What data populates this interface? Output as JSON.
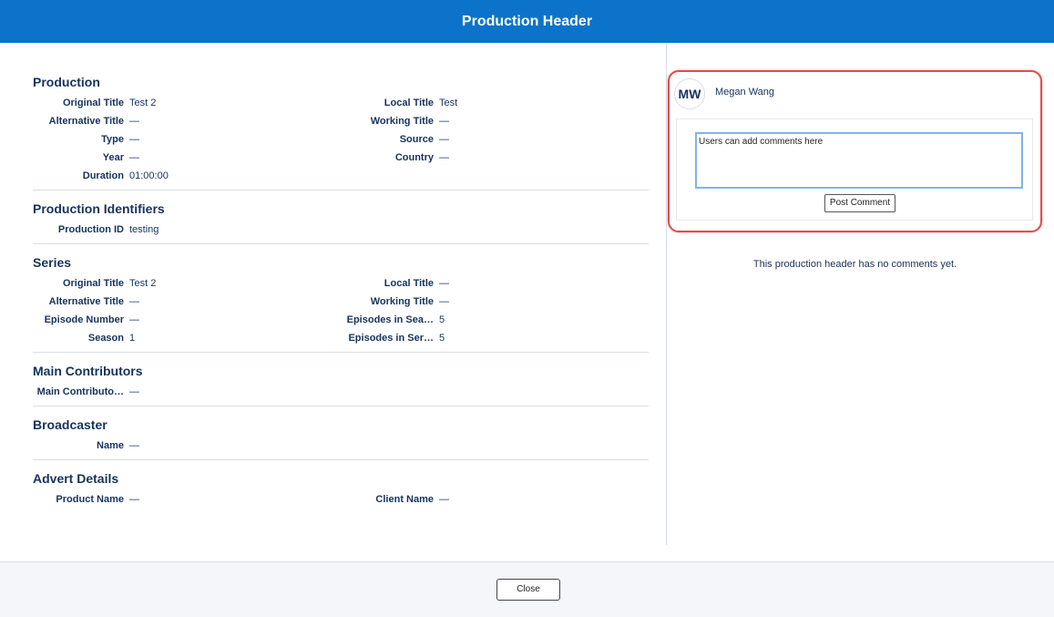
{
  "header": {
    "title": "Production Header"
  },
  "sections": [
    {
      "title": "Production",
      "fields": [
        {
          "label": "Original Title",
          "value": "Test 2"
        },
        {
          "label": "Local Title",
          "value": "Test"
        },
        {
          "label": "Alternative Title",
          "value": "—"
        },
        {
          "label": "Working Title",
          "value": "—"
        },
        {
          "label": "Type",
          "value": "—"
        },
        {
          "label": "Source",
          "value": "—"
        },
        {
          "label": "Year",
          "value": "—"
        },
        {
          "label": "Country",
          "value": "—"
        },
        {
          "label": "Duration",
          "value": "01:00:00"
        }
      ]
    },
    {
      "title": "Production Identifiers",
      "fields": [
        {
          "label": "Production ID",
          "value": "testing"
        }
      ]
    },
    {
      "title": "Series",
      "fields": [
        {
          "label": "Original Title",
          "value": "Test 2"
        },
        {
          "label": "Local Title",
          "value": "—"
        },
        {
          "label": "Alternative Title",
          "value": "—"
        },
        {
          "label": "Working Title",
          "value": "—"
        },
        {
          "label": "Episode Number",
          "value": "—"
        },
        {
          "label": "Episodes in Sea…",
          "value": "5"
        },
        {
          "label": "Season",
          "value": "1"
        },
        {
          "label": "Episodes in Ser…",
          "value": "5"
        }
      ]
    },
    {
      "title": "Main Contributors",
      "fields": [
        {
          "label": "Main Contributo…",
          "value": "—"
        }
      ]
    },
    {
      "title": "Broadcaster",
      "fields": [
        {
          "label": "Name",
          "value": "—"
        }
      ]
    },
    {
      "title": "Advert Details",
      "fields": [
        {
          "label": "Product Name",
          "value": "—"
        },
        {
          "label": "Client Name",
          "value": "—"
        }
      ]
    }
  ],
  "comments": {
    "avatar_initials": "MW",
    "author_name": "Megan Wang",
    "input_value": "Users can add comments here",
    "post_button": "Post Comment",
    "empty_text": "This production header has no comments yet."
  },
  "footer": {
    "close_button": "Close"
  }
}
